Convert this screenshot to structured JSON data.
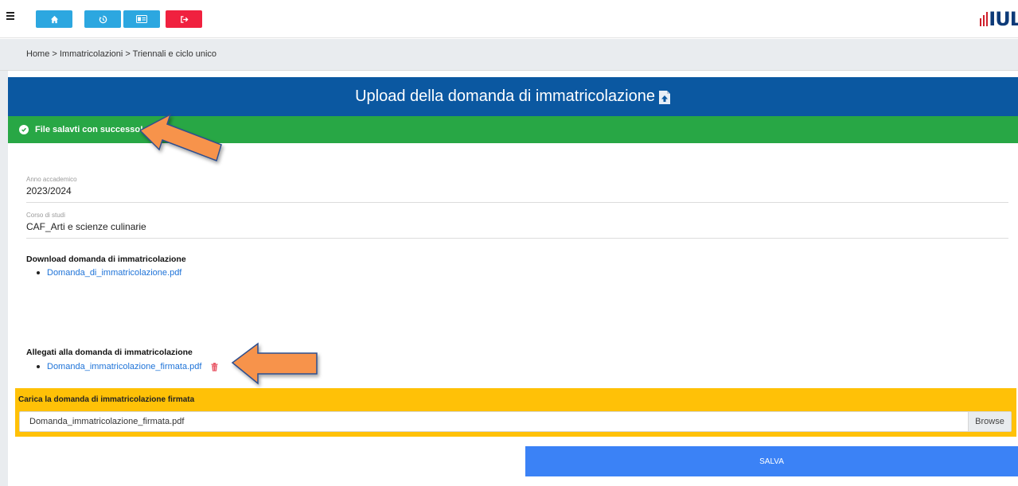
{
  "toolbar": {
    "buttons": [
      {
        "icon": "home-icon",
        "color": "#2ca7e0"
      },
      {
        "icon": "history-icon",
        "color": "#2ca7e0"
      },
      {
        "icon": "id-card-icon",
        "color": "#2ca7e0"
      },
      {
        "icon": "logout-icon",
        "color": "#f0213f"
      }
    ],
    "logo_text": "IUL"
  },
  "breadcrumb": "Home > Immatricolazioni > Triennali e ciclo unico",
  "header": {
    "title": "Upload della domanda di immatricolazione",
    "color": "#0b58a1"
  },
  "alert": {
    "text": "File salavti con successo!",
    "color": "#28a745"
  },
  "fields": {
    "anno": {
      "label": "Anno accademico",
      "value": "2023/2024"
    },
    "corso": {
      "label": "Corso di studi",
      "value": "CAF_Arti e scienze culinarie"
    }
  },
  "download": {
    "title": "Download domanda di immatricolazione",
    "items": [
      "Domanda_di_immatricolazione.pdf"
    ]
  },
  "allegati": {
    "title": "Allegati alla domanda di immatricolazione",
    "items": [
      "Domanda_immatricolazione_firmata.pdf"
    ]
  },
  "upload": {
    "title": "Carica la domanda di immatricolazione firmata",
    "filename": "Domanda_immatricolazione_firmata.pdf",
    "browse_label": "Browse",
    "color": "#ffc107"
  },
  "save_label": "SALVA",
  "annotation_color": "#f7934c"
}
